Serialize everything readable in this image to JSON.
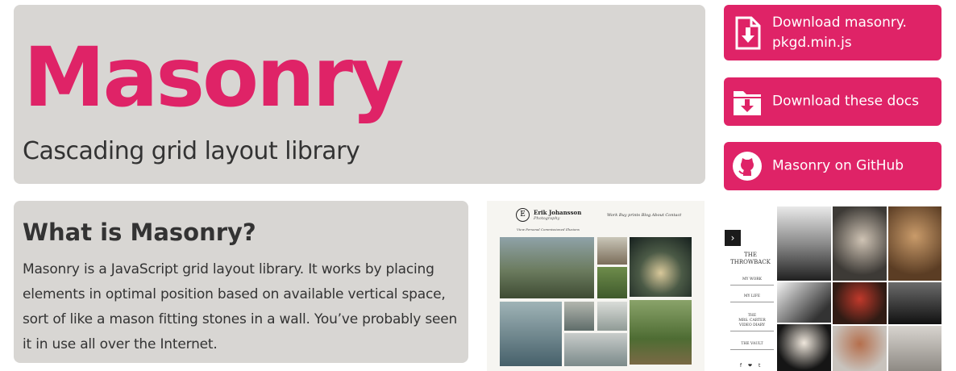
{
  "hero": {
    "title": "Masonry",
    "subtitle": "Cascading grid layout library"
  },
  "buttons": [
    {
      "label": "Download masonry.\npkgd.min.js",
      "icon": "download-file-icon"
    },
    {
      "label": "Download these docs",
      "icon": "download-folder-icon"
    },
    {
      "label": "Masonry on GitHub",
      "icon": "github-icon"
    }
  ],
  "about": {
    "heading": "What is Masonry?",
    "body": "Masonry is a JavaScript grid layout library. It works by placing elements in optimal position based on available vertical space, sort of like a mason fitting stones in a wall. You’ve probably seen it in use all over the Internet."
  },
  "example_site_1": {
    "logo_letter": "E",
    "name": "Erik Johansson",
    "tagline": "Photography",
    "nav": "Work   Buy prints   Blog   About   Contact",
    "subnav": "View   Personal   Commissioned   Illusions"
  },
  "example_site_2": {
    "brand": "THE\nTHROWBACK",
    "menu": [
      "MY WORK",
      "MY LIFE",
      "THE\nMRS. CARTER\nVIDEO DIARY",
      "THE VAULT"
    ],
    "social": "f ❤ t"
  },
  "colors": {
    "accent": "#df2367",
    "panel": "#d8d6d3",
    "text": "#333333"
  }
}
